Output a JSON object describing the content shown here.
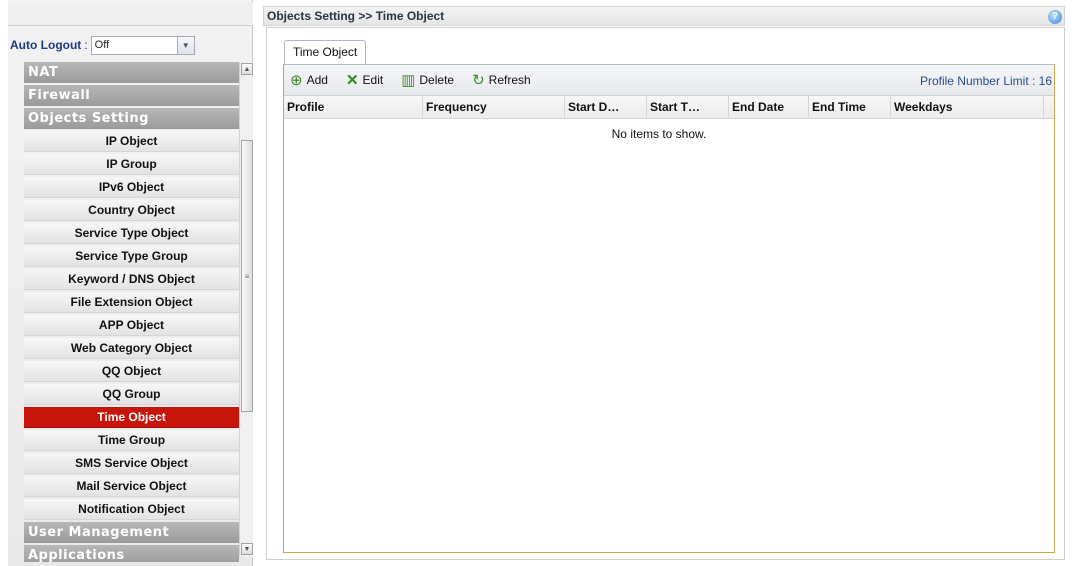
{
  "sidebar": {
    "auto_logout": {
      "label": "Auto Logout",
      "separator": ":",
      "value": "Off"
    },
    "menu": [
      {
        "type": "category",
        "label": "NAT"
      },
      {
        "type": "category",
        "label": "Firewall"
      },
      {
        "type": "category",
        "label": "Objects Setting"
      },
      {
        "type": "item",
        "label": "IP Object"
      },
      {
        "type": "item",
        "label": "IP Group"
      },
      {
        "type": "item",
        "label": "IPv6 Object"
      },
      {
        "type": "item",
        "label": "Country Object"
      },
      {
        "type": "item",
        "label": "Service Type Object"
      },
      {
        "type": "item",
        "label": "Service Type Group"
      },
      {
        "type": "item",
        "label": "Keyword / DNS Object"
      },
      {
        "type": "item",
        "label": "File Extension Object"
      },
      {
        "type": "item",
        "label": "APP Object"
      },
      {
        "type": "item",
        "label": "Web Category Object"
      },
      {
        "type": "item",
        "label": "QQ Object"
      },
      {
        "type": "item",
        "label": "QQ Group"
      },
      {
        "type": "item",
        "label": "Time Object",
        "active": true
      },
      {
        "type": "item",
        "label": "Time Group"
      },
      {
        "type": "item",
        "label": "SMS Service Object"
      },
      {
        "type": "item",
        "label": "Mail Service Object"
      },
      {
        "type": "item",
        "label": "Notification Object"
      },
      {
        "type": "category",
        "label": "User Management"
      },
      {
        "type": "category",
        "label": "Applications"
      }
    ]
  },
  "header": {
    "breadcrumb": "Objects Setting >> Time Object",
    "help_icon": "help-icon"
  },
  "tabs": [
    {
      "label": "Time Object",
      "active": true
    }
  ],
  "toolbar": {
    "add_label": "Add",
    "edit_label": "Edit",
    "delete_label": "Delete",
    "refresh_label": "Refresh",
    "limit_label": "Profile Number Limit : 16"
  },
  "table": {
    "columns": [
      "Profile",
      "Frequency",
      "Start D…",
      "Start T…",
      "End Date",
      "End Time",
      "Weekdays"
    ],
    "empty_message": "No items to show."
  },
  "colors": {
    "active_item": "#c8150b",
    "category_bg": "#a8a8a8",
    "label_blue": "#1a3b86"
  }
}
